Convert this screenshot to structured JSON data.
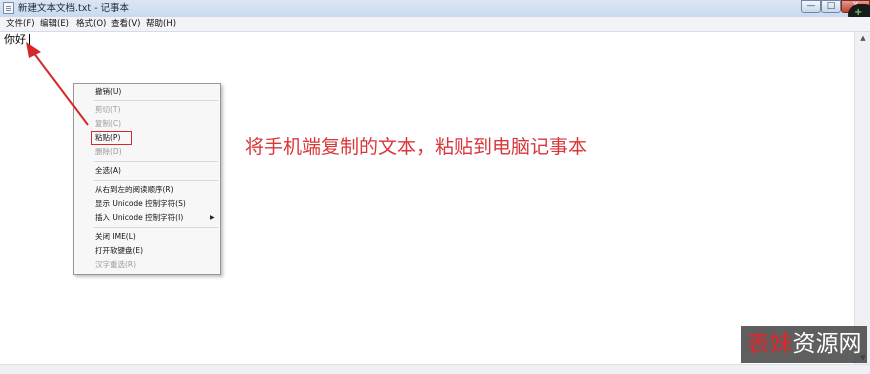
{
  "window": {
    "title": "新建文本文档.txt - 记事本",
    "minimize_glyph": "—",
    "maximize_glyph": "□",
    "close_glyph": "X"
  },
  "menubar": {
    "items": [
      "文件(F)",
      "编辑(E)",
      "格式(O)",
      "查看(V)",
      "帮助(H)"
    ]
  },
  "document": {
    "text": "你好"
  },
  "context_menu": {
    "items": [
      {
        "label": "撤销(U)",
        "enabled": true
      },
      {
        "label": "剪切(T)",
        "enabled": false
      },
      {
        "label": "复制(C)",
        "enabled": false
      },
      {
        "label": "粘贴(P)",
        "enabled": true,
        "highlighted": true
      },
      {
        "label": "删除(D)",
        "enabled": false
      },
      {
        "label": "全选(A)",
        "enabled": true
      },
      {
        "label": "从右到左的阅读顺序(R)",
        "enabled": true
      },
      {
        "label": "显示 Unicode 控制字符(S)",
        "enabled": true
      },
      {
        "label": "插入 Unicode 控制字符(I)",
        "enabled": true,
        "submenu": true
      },
      {
        "label": "关闭 IME(L)",
        "enabled": true
      },
      {
        "label": "打开软键盘(E)",
        "enabled": true
      },
      {
        "label": "汉字重选(R)",
        "enabled": false
      }
    ],
    "submenu_glyph": "▶"
  },
  "annotation": {
    "text": "将手机端复制的文本，粘贴到电脑记事本",
    "color": "#d9363b"
  },
  "watermark": {
    "part1": "表妹",
    "part2": "资源网"
  },
  "colors": {
    "accent_red": "#d22a2a",
    "disabled_text": "#9a9a9a"
  }
}
